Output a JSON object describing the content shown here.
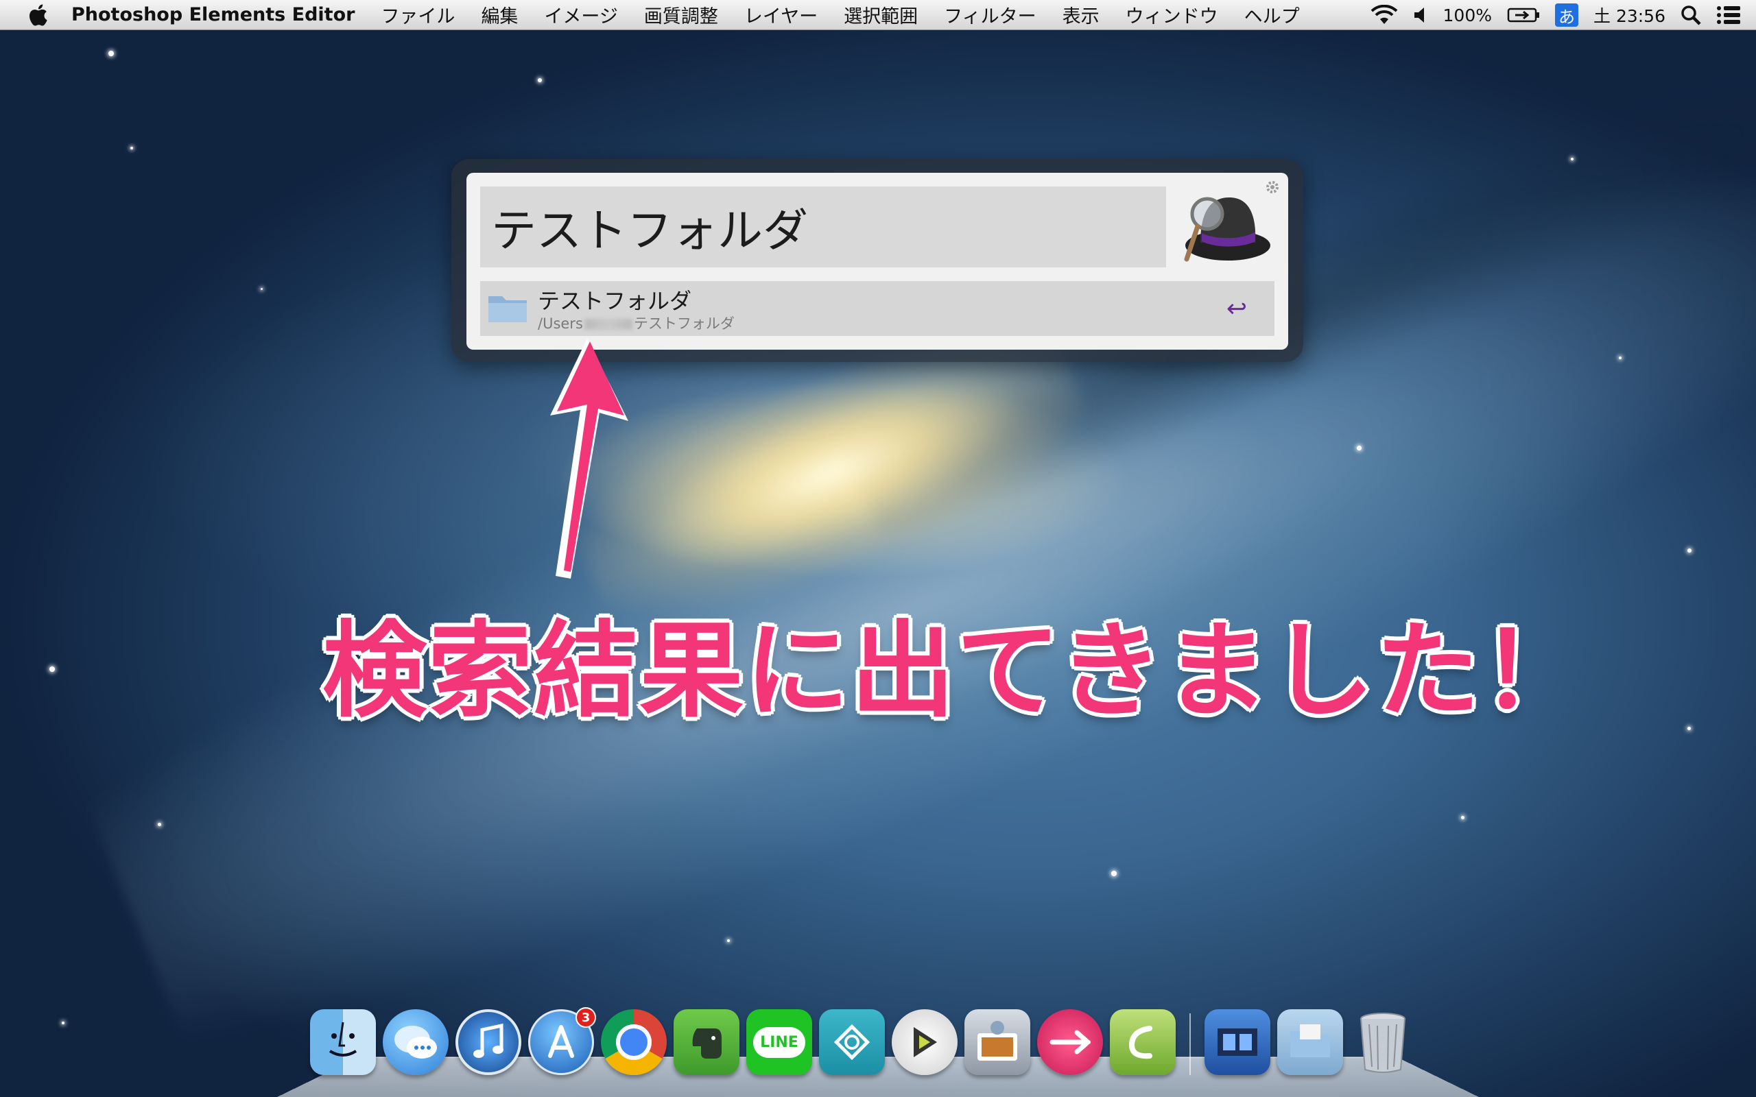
{
  "menubar": {
    "app_name": "Photoshop Elements Editor",
    "items": [
      "ファイル",
      "編集",
      "イメージ",
      "画質調整",
      "レイヤー",
      "選択範囲",
      "フィルター",
      "表示",
      "ウィンドウ",
      "ヘルプ"
    ],
    "battery": "100%",
    "ime": "あ",
    "clock": "土 23:56"
  },
  "alfred": {
    "query": "テストフォルダ",
    "result": {
      "title": "テストフォルダ",
      "path_prefix": "/Users",
      "path_suffix": "テストフォルダ"
    },
    "return_symbol": "↩"
  },
  "annotation": {
    "text": "検索結果に出てきました！",
    "color": "#f23677"
  },
  "dock": {
    "app_store_badge": "3",
    "line_label": "LINE"
  }
}
